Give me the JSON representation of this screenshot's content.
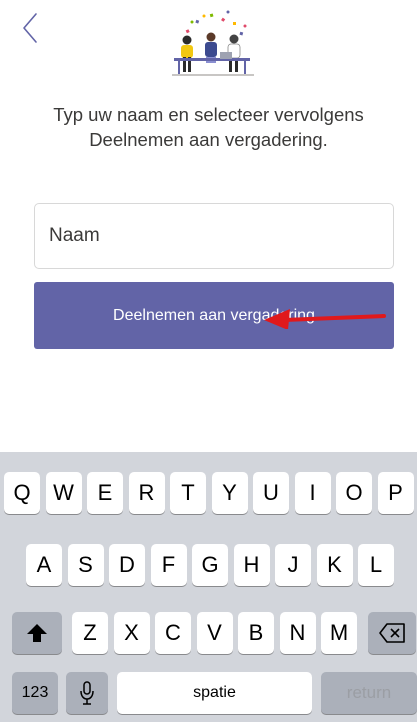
{
  "instruction": "Typ uw naam en selecteer vervolgens Deelnemen aan vergadering.",
  "name_field": {
    "placeholder": "Naam",
    "value": ""
  },
  "join_button": {
    "label": "Deelnemen aan vergadering"
  },
  "keyboard": {
    "row1": [
      "Q",
      "W",
      "E",
      "R",
      "T",
      "Y",
      "U",
      "I",
      "O",
      "P"
    ],
    "row2": [
      "A",
      "S",
      "D",
      "F",
      "G",
      "H",
      "J",
      "K",
      "L"
    ],
    "row3": [
      "Z",
      "X",
      "C",
      "V",
      "B",
      "N",
      "M"
    ],
    "numbers_label": "123",
    "space_label": "spatie",
    "return_label": "return"
  },
  "colors": {
    "accent": "#6264a7",
    "annotation_arrow": "#e0191c"
  },
  "icons": [
    "chevron-left-icon",
    "shift-icon",
    "backspace-icon",
    "microphone-icon"
  ]
}
